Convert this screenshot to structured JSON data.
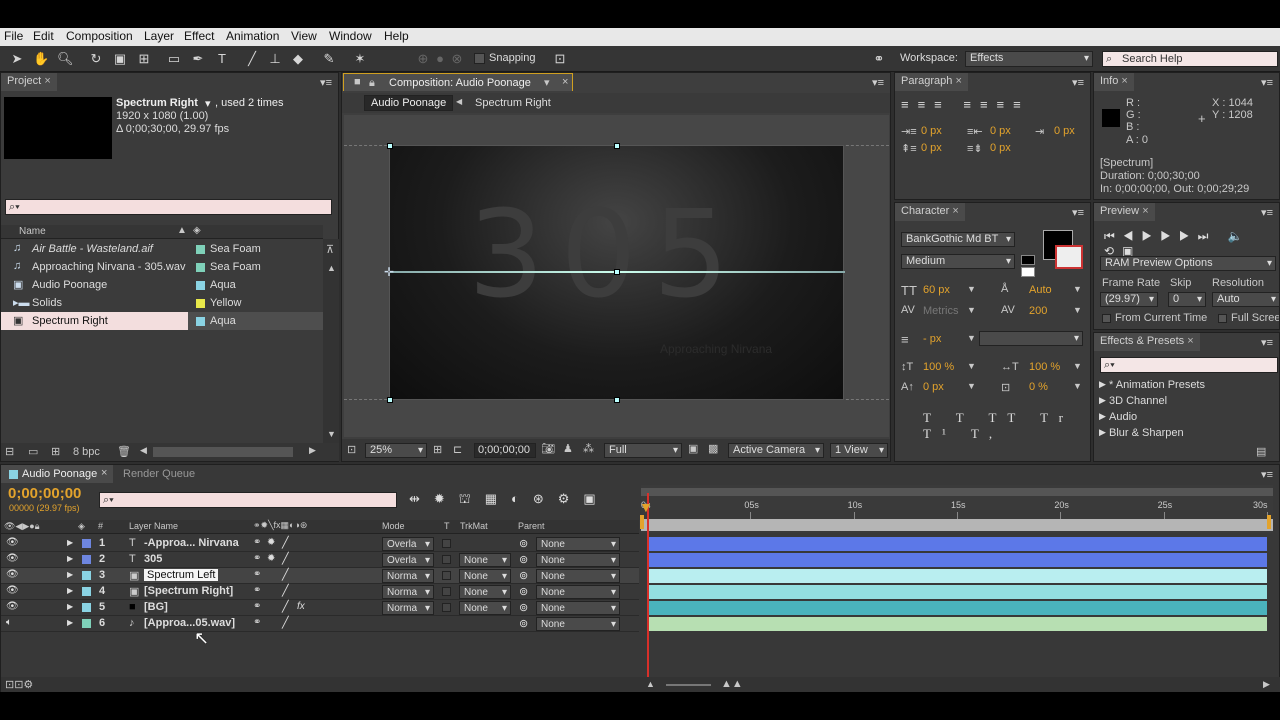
{
  "menu": [
    "File",
    "Edit",
    "Composition",
    "Layer",
    "Effect",
    "Animation",
    "View",
    "Window",
    "Help"
  ],
  "toolbar": {
    "snapping": "Snapping",
    "workspace_label": "Workspace:",
    "workspace_value": "Effects",
    "search_placeholder": "Search Help"
  },
  "project": {
    "tab": "Project",
    "item_name": "Spectrum Right",
    "item_used": ", used 2 times",
    "item_dims": "1920 x 1080 (1.00)",
    "item_duration": "Δ 0;00;30;00, 29.97 fps",
    "search_placeholder": "",
    "col_name": "Name",
    "rows": [
      {
        "name": "Air Battle - Wasteland.aif",
        "label": "Sea Foam",
        "color": "#7fd1b9",
        "icon": "audio-file-icon"
      },
      {
        "name": "Approaching Nirvana - 305.wav",
        "label": "Sea Foam",
        "color": "#7fd1b9",
        "icon": "audio-file-icon"
      },
      {
        "name": "Audio Poonage",
        "label": "Aqua",
        "color": "#8ad3e3",
        "icon": "composition-icon"
      },
      {
        "name": "Solids",
        "label": "Yellow",
        "color": "#e8e84a",
        "icon": "folder-icon"
      },
      {
        "name": "Spectrum Right",
        "label": "Aqua",
        "color": "#8ad3e3",
        "icon": "composition-icon"
      }
    ],
    "bpc": "8 bpc"
  },
  "comp": {
    "tab": "Composition: Audio Poonage",
    "crumb1": "Audio Poonage",
    "crumb2": "Spectrum Right",
    "big_text": "305",
    "sub_text": "Approaching Nirvana",
    "zoom": "25%",
    "timecode": "0;00;00;00",
    "resolution": "Full",
    "camera": "Active Camera",
    "views": "1 View"
  },
  "paragraph": {
    "tab": "Paragraph",
    "v1": "0 px",
    "v2": "0 px",
    "v3": "0 px",
    "v4": "0 px",
    "v5": "0 px"
  },
  "character": {
    "tab": "Character",
    "font": "BankGothic Md BT",
    "style": "Medium",
    "size": "60 px",
    "leading": "Auto",
    "kerning": "Metrics",
    "tracking": "200",
    "stroke": "- px",
    "vscale": "100 %",
    "hscale": "100 %",
    "baseline": "0 px",
    "tsume": "0 %"
  },
  "info": {
    "tab": "Info",
    "r": "R :",
    "g": "G :",
    "b": "B :",
    "a": "A : 0",
    "x": "X : 1044",
    "y": "Y : 1208",
    "name": "[Spectrum]",
    "duration": "Duration: 0;00;30;00",
    "inout": "In: 0;00;00;00, Out: 0;00;29;29"
  },
  "preview": {
    "tab": "Preview",
    "ram": "RAM Preview Options",
    "frame_rate_label": "Frame Rate",
    "skip_label": "Skip",
    "resolution_label": "Resolution",
    "frame_rate": "(29.97)",
    "skip": "0",
    "resolution": "Auto",
    "from_current": "From Current Time",
    "full_screen": "Full Screen"
  },
  "effects": {
    "tab": "Effects & Presets",
    "items": [
      "* Animation Presets",
      "3D Channel",
      "Audio",
      "Blur & Sharpen"
    ]
  },
  "timeline": {
    "tab": "Audio Poonage",
    "render_tab": "Render Queue",
    "timecode": "0;00;00;00",
    "fps": "00000 (29.97 fps)",
    "col_num": "#",
    "col_layer": "Layer Name",
    "col_mode": "Mode",
    "col_t": "T",
    "col_trkmat": "TrkMat",
    "col_parent": "Parent",
    "ruler": [
      "0s",
      "05s",
      "10s",
      "15s",
      "20s",
      "25s",
      "30s"
    ],
    "layers": [
      {
        "num": "1",
        "name": "-Approa... Nirvana",
        "mode": "Overla",
        "trkmat": "",
        "parent": "None",
        "color": "#6e86e0",
        "bar": "#5c78e8",
        "icon": "T"
      },
      {
        "num": "2",
        "name": "305",
        "mode": "Overla",
        "trkmat": "None",
        "parent": "None",
        "color": "#6e86e0",
        "bar": "#5c78e8",
        "icon": "T"
      },
      {
        "num": "3",
        "name": "Spectrum Left",
        "mode": "Norma",
        "trkmat": "None",
        "parent": "None",
        "color": "#8ad3e3",
        "bar": "#b9eef0",
        "icon": "comp"
      },
      {
        "num": "4",
        "name": "[Spectrum Right]",
        "mode": "Norma",
        "trkmat": "None",
        "parent": "None",
        "color": "#8ad3e3",
        "bar": "#93dfe0",
        "icon": "comp"
      },
      {
        "num": "5",
        "name": "[BG]",
        "mode": "Norma",
        "trkmat": "None",
        "parent": "None",
        "color": "#8ad3e3",
        "bar": "#4ab3bd",
        "icon": "solid"
      },
      {
        "num": "6",
        "name": "[Approa...05.wav]",
        "mode": "",
        "trkmat": "",
        "parent": "None",
        "color": "#7fd1b9",
        "bar": "#b7dfb2",
        "icon": "audio"
      }
    ]
  }
}
